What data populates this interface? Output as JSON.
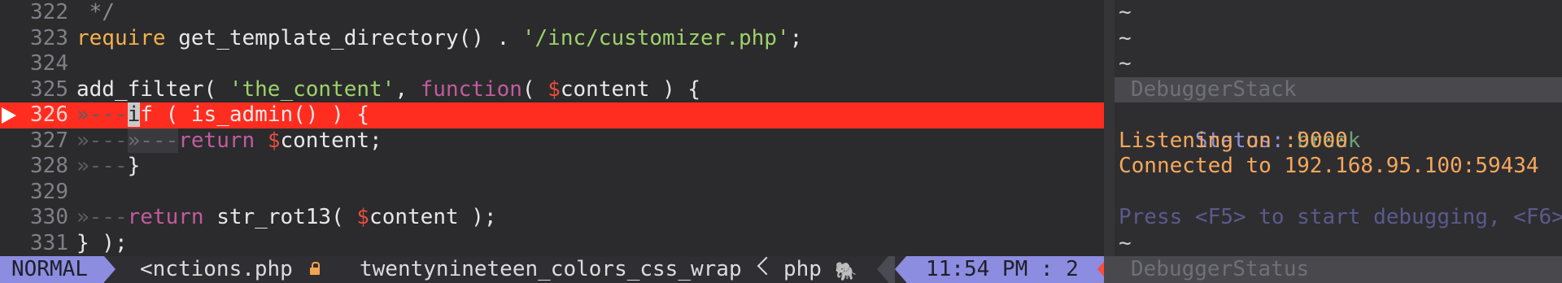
{
  "editor": {
    "lines": [
      {
        "num": "322",
        "tokens": [
          {
            "t": " */",
            "c": "c-comment"
          }
        ]
      },
      {
        "num": "323",
        "tokens": [
          {
            "t": "require",
            "c": "c-kw"
          },
          {
            "t": " get_template_directory() . ",
            "c": "c-fn"
          },
          {
            "t": "'/inc/customizer.php'",
            "c": "c-str"
          },
          {
            "t": ";",
            "c": "c-fn"
          }
        ]
      },
      {
        "num": "324",
        "tokens": []
      },
      {
        "num": "325",
        "tokens": [
          {
            "t": "add_filter( ",
            "c": "c-fn"
          },
          {
            "t": "'the_content'",
            "c": "c-str"
          },
          {
            "t": ", ",
            "c": "c-fn"
          },
          {
            "t": "function",
            "c": "c-func"
          },
          {
            "t": "( ",
            "c": "c-fn"
          },
          {
            "t": "$",
            "c": "c-var"
          },
          {
            "t": "content ) {",
            "c": "c-fn"
          }
        ]
      },
      {
        "num": "326",
        "breakpoint": true,
        "tokens": [
          {
            "t": "»---",
            "c": "c-ind"
          },
          {
            "t": "i",
            "c": "cursor"
          },
          {
            "t": "f ( is_admin() ) {",
            "c": "c-fn"
          }
        ]
      },
      {
        "num": "327",
        "tokens": [
          {
            "t": "»---",
            "c": "c-ind"
          },
          {
            "t": "»---",
            "c": "c-ind-bg"
          },
          {
            "t": "return",
            "c": "c-func"
          },
          {
            "t": " ",
            "c": "c-fn"
          },
          {
            "t": "$",
            "c": "c-var"
          },
          {
            "t": "content;",
            "c": "c-fn"
          }
        ]
      },
      {
        "num": "328",
        "tokens": [
          {
            "t": "»---",
            "c": "c-ind"
          },
          {
            "t": "}",
            "c": "c-fn"
          }
        ]
      },
      {
        "num": "329",
        "tokens": []
      },
      {
        "num": "330",
        "tokens": [
          {
            "t": "»---",
            "c": "c-ind"
          },
          {
            "t": "return",
            "c": "c-func"
          },
          {
            "t": " str_rot13( ",
            "c": "c-fn"
          },
          {
            "t": "$",
            "c": "c-var"
          },
          {
            "t": "content );",
            "c": "c-fn"
          }
        ]
      },
      {
        "num": "331",
        "tokens": [
          {
            "t": "} );",
            "c": "c-fn"
          }
        ]
      }
    ]
  },
  "debugger": {
    "tilde": "~",
    "stack_title": "DebuggerStack",
    "status_label": "Status:",
    "status_value": "break",
    "listening": "Listening on :9000",
    "connected": "Connected to 192.168.95.100:59434",
    "hint": "Press <F5> to start debugging, <F6>",
    "status_title": "DebuggerStatus"
  },
  "statusline": {
    "mode": "NORMAL",
    "file": "<nctions.php",
    "function": "twentynineteen_colors_css_wrap",
    "filetype": "php",
    "filetype_icon": "elephant-icon",
    "position": "11:54 PM : 2"
  },
  "colors": {
    "accent": "#8c8ce0",
    "breakpoint_line": "#ff2d20",
    "string": "#9dd26a",
    "keyword": "#f4b04d"
  }
}
